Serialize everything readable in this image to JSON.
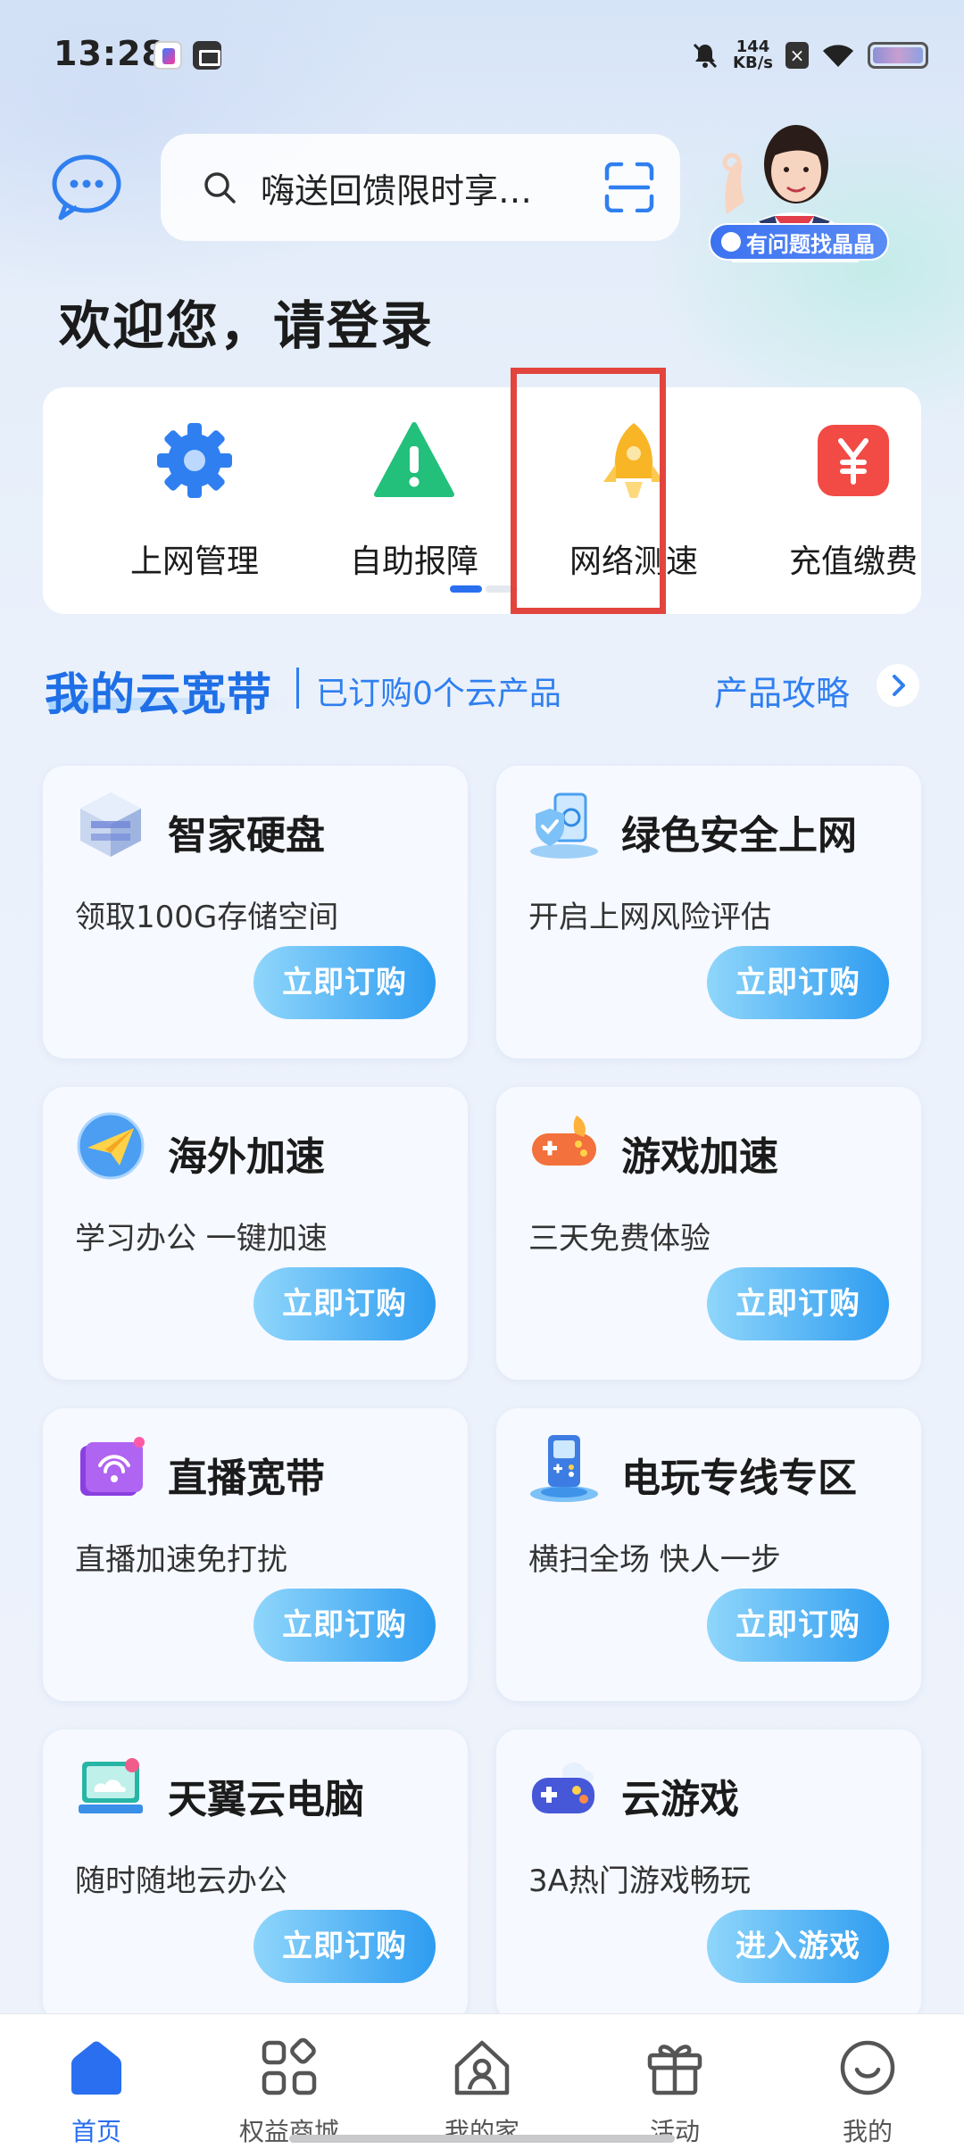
{
  "status_bar": {
    "time": "13:28",
    "net_speed_value": "144",
    "net_speed_unit": "KB/s",
    "icons": [
      "app-notification-icon",
      "message-box-icon",
      "mute-bell-icon",
      "sim-x-icon",
      "wifi-icon",
      "battery-icon"
    ]
  },
  "header": {
    "search_text": "嗨送回馈限时享…",
    "agent_badge": "有问题找晶晶",
    "welcome": "欢迎您，请登录"
  },
  "quick_actions": [
    {
      "label": "上网管理",
      "icon": "gear-icon",
      "color": "#2f7ff0"
    },
    {
      "label": "自助报障",
      "icon": "warning-triangle-icon",
      "color": "#22c07a"
    },
    {
      "label": "网络测速",
      "icon": "rocket-icon",
      "color": "#f8b526"
    },
    {
      "label": "充值缴费",
      "icon": "yuan-icon",
      "color": "#f24a45"
    }
  ],
  "section": {
    "title": "我的云宽带",
    "subtitle": "已订购0个云产品",
    "link": "产品攻略"
  },
  "products": [
    {
      "title": "智家硬盘",
      "desc": "领取100G存储空间",
      "button": "立即订购",
      "icon": "hard-disk-icon"
    },
    {
      "title": "绿色安全上网",
      "desc": "开启上网风险评估",
      "button": "立即订购",
      "icon": "secure-browsing-icon"
    },
    {
      "title": "海外加速",
      "desc": "学习办公 一键加速",
      "button": "立即订购",
      "icon": "paper-plane-icon"
    },
    {
      "title": "游戏加速",
      "desc": "三天免费体验",
      "button": "立即订购",
      "icon": "gamepad-rocket-icon"
    },
    {
      "title": "直播宽带",
      "desc": "直播加速免打扰",
      "button": "立即订购",
      "icon": "wifi-box-icon"
    },
    {
      "title": "电玩专线专区",
      "desc": "横扫全场 快人一步",
      "button": "立即订购",
      "icon": "handheld-console-icon"
    },
    {
      "title": "天翼云电脑",
      "desc": "随时随地云办公",
      "button": "立即订购",
      "icon": "cloud-computer-icon"
    },
    {
      "title": "云游戏",
      "desc": "3A热门游戏畅玩",
      "button": "进入游戏",
      "icon": "cloud-gamepad-icon"
    }
  ],
  "bottom_nav": [
    {
      "label": "首页",
      "icon": "home-icon",
      "active": true
    },
    {
      "label": "权益商城",
      "icon": "apps-grid-icon",
      "active": false
    },
    {
      "label": "我的家",
      "icon": "house-user-icon",
      "active": false
    },
    {
      "label": "活动",
      "icon": "gift-icon",
      "active": false
    },
    {
      "label": "我的",
      "icon": "smiley-icon",
      "active": false
    }
  ],
  "colors": {
    "accent": "#2f7ff0",
    "highlight_box": "#e2453e",
    "button_gradient_start": "#8fd6fb",
    "button_gradient_end": "#2e9cf0"
  }
}
